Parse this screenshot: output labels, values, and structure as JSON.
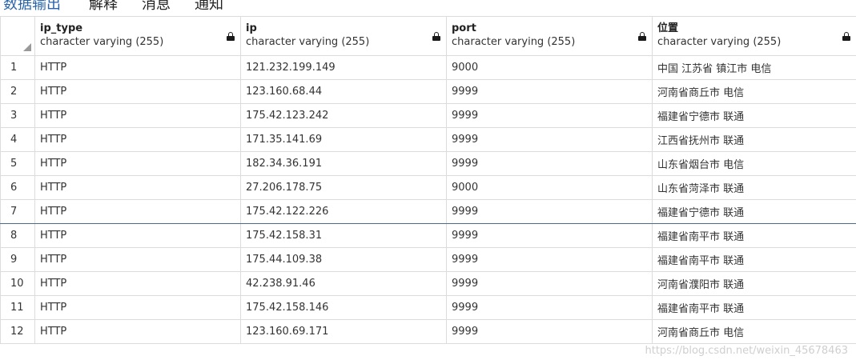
{
  "tabs": [
    {
      "label": "数据输出",
      "active": true
    },
    {
      "label": "解释",
      "active": false
    },
    {
      "label": "消息",
      "active": false
    },
    {
      "label": "通知",
      "active": false
    }
  ],
  "columns": [
    {
      "name": "ip_type",
      "type": "character varying (255)",
      "icon": "lock-icon"
    },
    {
      "name": "ip",
      "type": "character varying (255)",
      "icon": "lock-icon"
    },
    {
      "name": "port",
      "type": "character varying (255)",
      "icon": "lock-icon"
    },
    {
      "name": "位置",
      "type": "character varying (255)",
      "icon": "lock-icon"
    }
  ],
  "rows": [
    {
      "num": "1",
      "cells": [
        "HTTP",
        "121.232.199.149",
        "9000",
        "中国 江苏省 镇江市 电信"
      ]
    },
    {
      "num": "2",
      "cells": [
        "HTTP",
        "123.160.68.44",
        "9999",
        "河南省商丘市  电信"
      ]
    },
    {
      "num": "3",
      "cells": [
        "HTTP",
        "175.42.123.242",
        "9999",
        "福建省宁德市  联通"
      ]
    },
    {
      "num": "4",
      "cells": [
        "HTTP",
        "171.35.141.69",
        "9999",
        "江西省抚州市  联通"
      ]
    },
    {
      "num": "5",
      "cells": [
        "HTTP",
        "182.34.36.191",
        "9999",
        "山东省烟台市  电信"
      ]
    },
    {
      "num": "6",
      "cells": [
        "HTTP",
        "27.206.178.75",
        "9000",
        "山东省菏泽市  联通"
      ]
    },
    {
      "num": "7",
      "cells": [
        "HTTP",
        "175.42.122.226",
        "9999",
        "福建省宁德市  联通"
      ],
      "selected": true
    },
    {
      "num": "8",
      "cells": [
        "HTTP",
        "175.42.158.31",
        "9999",
        "福建省南平市  联通"
      ]
    },
    {
      "num": "9",
      "cells": [
        "HTTP",
        "175.44.109.38",
        "9999",
        "福建省南平市  联通"
      ]
    },
    {
      "num": "10",
      "cells": [
        "HTTP",
        "42.238.91.46",
        "9999",
        "河南省濮阳市  联通"
      ]
    },
    {
      "num": "11",
      "cells": [
        "HTTP",
        "175.42.158.146",
        "9999",
        "福建省南平市  联通"
      ]
    },
    {
      "num": "12",
      "cells": [
        "HTTP",
        "123.160.69.171",
        "9999",
        "河南省商丘市  电信"
      ]
    }
  ],
  "watermark": "https://blog.csdn.net/weixin_45678463",
  "colors": {
    "active_tab": "#2a64a8",
    "grid_border": "#dcdcdc",
    "selected_row_border": "#4a6b8a"
  }
}
